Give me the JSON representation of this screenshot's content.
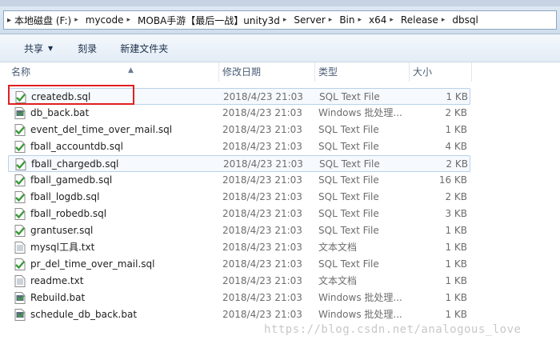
{
  "breadcrumb": [
    "本地磁盘 (F:)",
    "mycode",
    "MOBA手游【最后一战】unity3d",
    "Server",
    "Bin",
    "x64",
    "Release",
    "dbsql"
  ],
  "toolbar": {
    "share": "共享",
    "burn": "刻录",
    "new_folder": "新建文件夹"
  },
  "columns": {
    "name": "名称",
    "date": "修改日期",
    "type": "类型",
    "size": "大小"
  },
  "files": [
    {
      "name": "createdb.sql",
      "date": "2018/4/23 21:03",
      "type": "SQL Text File",
      "size": "1 KB",
      "icon": "sql-file-icon"
    },
    {
      "name": "db_back.bat",
      "date": "2018/4/23 21:03",
      "type": "Windows 批处理...",
      "size": "2 KB",
      "icon": "bat-file-icon"
    },
    {
      "name": "event_del_time_over_mail.sql",
      "date": "2018/4/23 21:03",
      "type": "SQL Text File",
      "size": "1 KB",
      "icon": "sql-file-icon"
    },
    {
      "name": "fball_accountdb.sql",
      "date": "2018/4/23 21:03",
      "type": "SQL Text File",
      "size": "4 KB",
      "icon": "sql-file-icon"
    },
    {
      "name": "fball_chargedb.sql",
      "date": "2018/4/23 21:03",
      "type": "SQL Text File",
      "size": "2 KB",
      "icon": "sql-file-icon"
    },
    {
      "name": "fball_gamedb.sql",
      "date": "2018/4/23 21:03",
      "type": "SQL Text File",
      "size": "16 KB",
      "icon": "sql-file-icon"
    },
    {
      "name": "fball_logdb.sql",
      "date": "2018/4/23 21:03",
      "type": "SQL Text File",
      "size": "2 KB",
      "icon": "sql-file-icon"
    },
    {
      "name": "fball_robedb.sql",
      "date": "2018/4/23 21:03",
      "type": "SQL Text File",
      "size": "3 KB",
      "icon": "sql-file-icon"
    },
    {
      "name": "grantuser.sql",
      "date": "2018/4/23 21:03",
      "type": "SQL Text File",
      "size": "1 KB",
      "icon": "sql-file-icon"
    },
    {
      "name": "mysql工具.txt",
      "date": "2018/4/23 21:03",
      "type": "文本文档",
      "size": "1 KB",
      "icon": "txt-file-icon"
    },
    {
      "name": "pr_del_time_over_mail.sql",
      "date": "2018/4/23 21:03",
      "type": "SQL Text File",
      "size": "1 KB",
      "icon": "sql-file-icon"
    },
    {
      "name": "readme.txt",
      "date": "2018/4/23 21:03",
      "type": "文本文档",
      "size": "1 KB",
      "icon": "txt-file-icon"
    },
    {
      "name": "Rebuild.bat",
      "date": "2018/4/23 21:03",
      "type": "Windows 批处理...",
      "size": "1 KB",
      "icon": "bat-file-icon"
    },
    {
      "name": "schedule_db_back.bat",
      "date": "2018/4/23 21:03",
      "type": "Windows 批处理...",
      "size": "1 KB",
      "icon": "bat-file-icon"
    }
  ],
  "highlighted_rows": [
    0,
    4
  ],
  "watermark": "https://blog.csdn.net/analogous_love",
  "colors": {
    "annotation_box": "#e02020",
    "sql_icon_green": "#3a9a3a",
    "header_text": "#4b5d76"
  }
}
